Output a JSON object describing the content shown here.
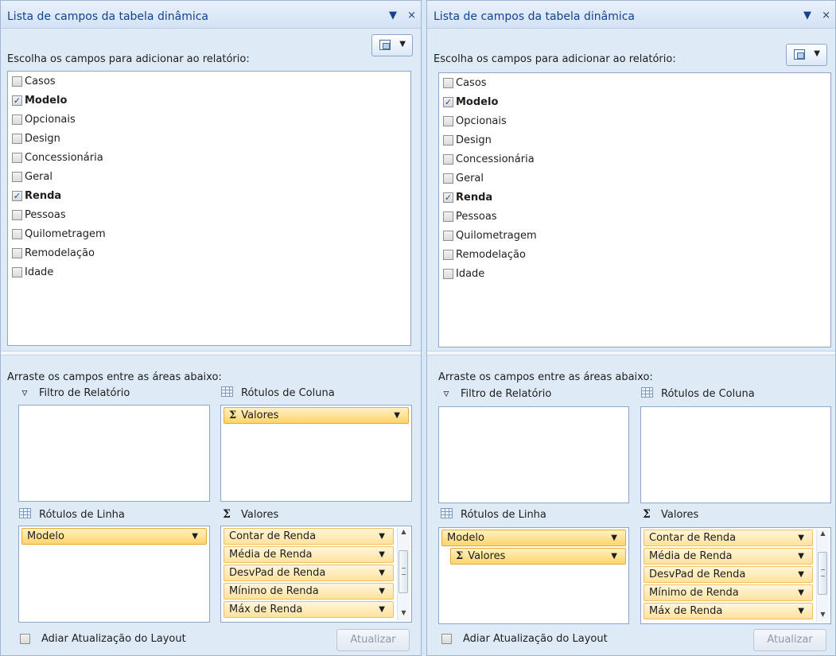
{
  "panels": [
    {
      "title": "Lista de campos da tabela dinâmica",
      "choose_label": "Escolha os campos para adicionar ao relatório:",
      "fields": [
        {
          "label": "Casos",
          "checked": false
        },
        {
          "label": "Modelo",
          "checked": true
        },
        {
          "label": "Opcionais",
          "checked": false
        },
        {
          "label": "Design",
          "checked": false
        },
        {
          "label": "Concessionária",
          "checked": false
        },
        {
          "label": "Geral",
          "checked": false
        },
        {
          "label": "Renda",
          "checked": true
        },
        {
          "label": "Pessoas",
          "checked": false
        },
        {
          "label": "Quilometragem",
          "checked": false
        },
        {
          "label": "Remodelação",
          "checked": false
        },
        {
          "label": "Idade",
          "checked": false
        }
      ],
      "drag_label": "Arraste os campos entre as áreas abaixo:",
      "areas": {
        "report_filter": {
          "label": "Filtro de Relatório",
          "items": []
        },
        "column_labels": {
          "label": "Rótulos de Coluna",
          "items": [
            "Valores"
          ]
        },
        "row_labels": {
          "label": "Rótulos de Linha",
          "items": [
            "Modelo"
          ]
        },
        "values": {
          "label": "Valores",
          "items": [
            "Contar de Renda",
            "Média de Renda",
            "DesvPad de Renda",
            "Mínimo de Renda",
            "Máx de Renda"
          ]
        }
      },
      "defer_label": "Adiar Atualização do Layout",
      "update_label": "Atualizar"
    },
    {
      "title": "Lista de campos da tabela dinâmica",
      "choose_label": "Escolha os campos para adicionar ao relatório:",
      "fields": [
        {
          "label": "Casos",
          "checked": false
        },
        {
          "label": "Modelo",
          "checked": true
        },
        {
          "label": "Opcionais",
          "checked": false
        },
        {
          "label": "Design",
          "checked": false
        },
        {
          "label": "Concessionária",
          "checked": false
        },
        {
          "label": "Geral",
          "checked": false
        },
        {
          "label": "Renda",
          "checked": true
        },
        {
          "label": "Pessoas",
          "checked": false
        },
        {
          "label": "Quilometragem",
          "checked": false
        },
        {
          "label": "Remodelação",
          "checked": false
        },
        {
          "label": "Idade",
          "checked": false
        }
      ],
      "drag_label": "Arraste os campos entre as áreas abaixo:",
      "areas": {
        "report_filter": {
          "label": "Filtro de Relatório",
          "items": []
        },
        "column_labels": {
          "label": "Rótulos de Coluna",
          "items": []
        },
        "row_labels": {
          "label": "Rótulos de Linha",
          "items": [
            "Modelo",
            "Valores"
          ]
        },
        "values": {
          "label": "Valores",
          "items": [
            "Contar de Renda",
            "Média de Renda",
            "DesvPad de Renda",
            "Mínimo de Renda",
            "Máx de Renda"
          ]
        }
      },
      "defer_label": "Adiar Atualização do Layout",
      "update_label": "Atualizar"
    }
  ],
  "glyphs": {
    "dropdown": "▼",
    "close": "×",
    "check": "✓",
    "sigma": "Σ",
    "scroll_up": "▲",
    "scroll_down": "▼"
  },
  "colors": {
    "title_text": "#15428b",
    "panel_bg": "#dfeaf7",
    "item_bg": "#ffe39c",
    "item_border": "#f0c060"
  }
}
